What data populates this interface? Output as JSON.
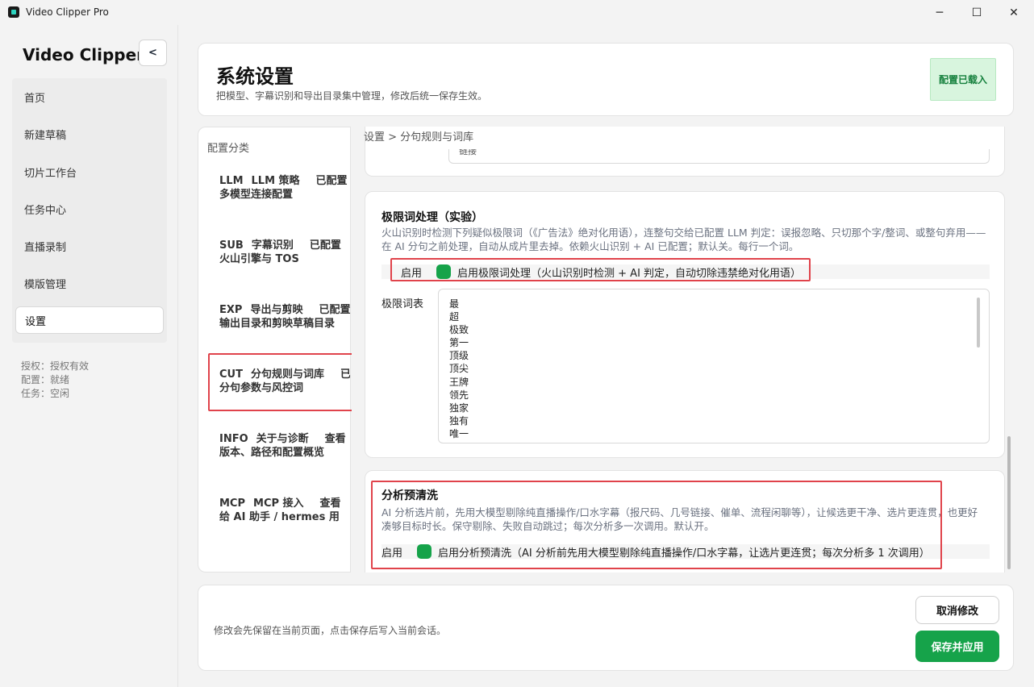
{
  "window": {
    "title": "Video Clipper Pro",
    "icon": "app-logo-icon",
    "minimize": "─",
    "maximize": "☐",
    "close": "✕"
  },
  "sidebar": {
    "brand": "Video Clipper",
    "collapse_label": "<",
    "items": [
      {
        "label": "首页"
      },
      {
        "label": "新建草稿"
      },
      {
        "label": "切片工作台"
      },
      {
        "label": "任务中心"
      },
      {
        "label": "直播录制"
      },
      {
        "label": "模版管理"
      },
      {
        "label": "设置",
        "active": true
      }
    ],
    "status": {
      "license": "授权：授权有效",
      "config": "配置：就绪",
      "task": "任务：空闲"
    }
  },
  "header": {
    "title": "系统设置",
    "subtitle": "把模型、字幕识别和导出目录集中管理，修改后统一保存生效。",
    "badge": "配置已载入"
  },
  "categories": {
    "heading": "配置分类",
    "items": [
      {
        "code": "LLM",
        "name": "LLM 策略",
        "status": "已配置",
        "desc": "多模型连接配置"
      },
      {
        "code": "SUB",
        "name": "字幕识别",
        "status": "已配置",
        "desc": "火山引擎与 TOS"
      },
      {
        "code": "EXP",
        "name": "导出与剪映",
        "status": "已配置",
        "desc": "输出目录和剪映草稿目录"
      },
      {
        "code": "CUT",
        "name": "分句规则与词库",
        "status": "已启",
        "desc": "分句参数与风控词",
        "selected": true
      },
      {
        "code": "INFO",
        "name": "关于与诊断",
        "status": "查看",
        "desc": "版本、路径和配置概览"
      },
      {
        "code": "MCP",
        "name": "MCP 接入",
        "status": "查看",
        "desc": "给 AI 助手 / hermes 用"
      }
    ]
  },
  "content": {
    "breadcrumb": "设置 > 分句规则与词库",
    "prev_card_text": "链接",
    "extreme": {
      "title": "极限词处理（实验）",
      "desc": "火山识别时检测下列疑似极限词（《广告法》绝对化用语），连整句交给已配置 LLM 判定：误报忽略、只切那个字/整词、或整句弃用——在 AI 分句之前处理，自动从成片里去掉。依赖火山识别 + AI 已配置；默认关。每行一个词。",
      "toggle_label": "启用",
      "toggle_text": "启用极限词处理（火山识别时检测 + AI 判定，自动切除违禁绝对化用语）",
      "list_label": "极限词表",
      "words": [
        "最",
        "超",
        "极致",
        "第一",
        "顶级",
        "顶尖",
        "王牌",
        "领先",
        "独家",
        "独有",
        "唯一"
      ]
    },
    "preclean": {
      "title": "分析预清洗",
      "desc": "AI 分析选片前，先用大模型剔除纯直播操作/口水字幕（报尺码、几号链接、催单、流程闲聊等），让候选更干净、选片更连贯，也更好凑够目标时长。保守剔除、失败自动跳过；每次分析多一次调用。默认开。",
      "toggle_label": "启用",
      "toggle_text": "启用分析预清洗（AI 分析前先用大模型剔除纯直播操作/口水字幕，让选片更连贯；每次分析多 1 次调用）"
    }
  },
  "footer": {
    "note": "修改会先保留在当前页面，点击保存后写入当前会话。",
    "cancel": "取消修改",
    "save": "保存并应用"
  },
  "colors": {
    "accent": "#16a34a",
    "highlight": "#e0434b",
    "badge_bg": "#d8f5de"
  }
}
